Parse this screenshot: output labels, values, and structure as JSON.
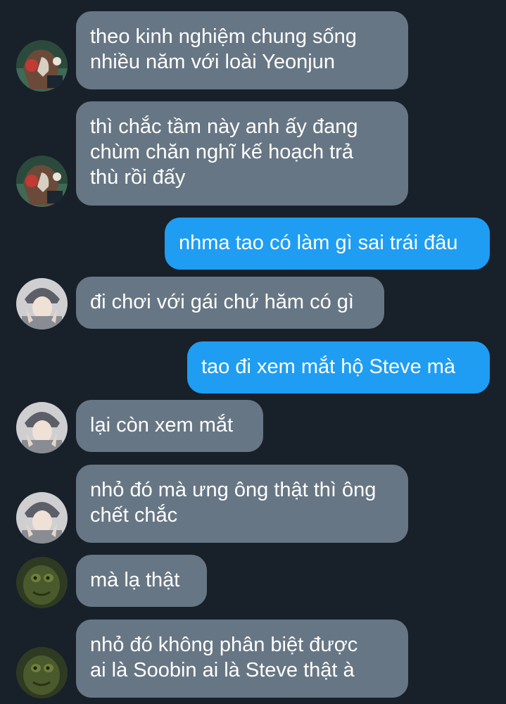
{
  "conversation": {
    "messages": [
      {
        "side": "in",
        "sender": "witch",
        "lines": [
          "theo kinh nghiệm chung sống",
          "nhiều năm với loài Yeonjun"
        ]
      },
      {
        "side": "in",
        "sender": "witch",
        "lines": [
          "thì chắc tầm này anh ấy đang",
          "chùm chăn nghĩ kế hoạch trả",
          "thù rồi đấy"
        ]
      },
      {
        "side": "out",
        "lines": [
          "nhma tao có làm gì sai trái đâu"
        ]
      },
      {
        "side": "in",
        "sender": "boy",
        "lines": [
          "đi chơi với gái chứ hăm có gì"
        ]
      },
      {
        "side": "out",
        "lines": [
          "tao đi xem mắt hộ Steve mà"
        ]
      },
      {
        "side": "in",
        "sender": "boy",
        "lines": [
          "lại còn xem mắt"
        ]
      },
      {
        "side": "in",
        "sender": "boy",
        "lines": [
          "nhỏ đó mà ưng ông thật thì ông",
          "chết chắc"
        ]
      },
      {
        "side": "in",
        "sender": "creature",
        "lines": [
          "mà lạ thật"
        ]
      },
      {
        "side": "in",
        "sender": "creature",
        "lines": [
          "nhỏ đó không phân biệt được",
          "ai là Soobin ai là Steve thật à"
        ]
      }
    ]
  },
  "colors": {
    "background": "#18202a",
    "incoming_bubble": "#677684",
    "outgoing_bubble": "#1f9df3",
    "text": "#ffffff"
  },
  "avatars": {
    "witch": "witch-portrait-avatar",
    "boy": "person-portrait-avatar",
    "creature": "green-creature-avatar"
  }
}
